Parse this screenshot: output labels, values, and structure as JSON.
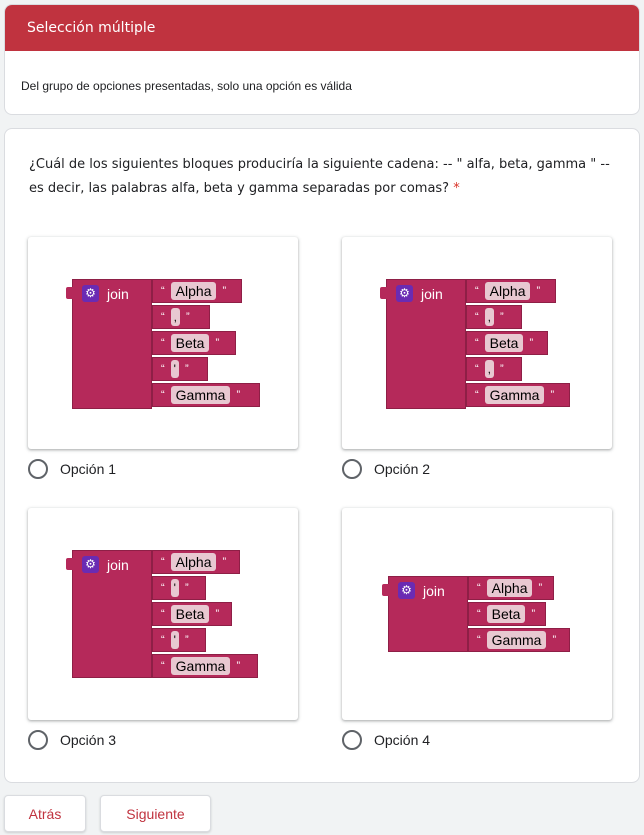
{
  "section": {
    "title": "Selección múltiple",
    "description": "Del grupo de opciones presentadas, solo una opción es válida"
  },
  "question": {
    "text": "¿Cuál de los siguientes bloques produciría la siguiente cadena: -- \" alfa, beta, gamma \" -- es decir, las palabras alfa, beta y gamma separadas por comas?",
    "required_mark": "*"
  },
  "block_label": "join",
  "options": [
    {
      "label": "Opción 1",
      "items": [
        "Alpha",
        ",",
        "Beta",
        "'",
        "Gamma"
      ]
    },
    {
      "label": "Opción 2",
      "items": [
        "Alpha",
        ",",
        "Beta",
        ",",
        "Gamma"
      ]
    },
    {
      "label": "Opción 3",
      "items": [
        "Alpha",
        "'",
        "Beta",
        "'",
        "Gamma"
      ]
    },
    {
      "label": "Opción 4",
      "items": [
        "Alpha",
        "Beta",
        "Gamma"
      ]
    }
  ],
  "nav": {
    "back": "Atrás",
    "next": "Siguiente"
  },
  "colors": {
    "header": "#c0333f",
    "block": "#b5295a",
    "gear": "#6a2bb3"
  },
  "icons": [
    "gear-icon",
    "radio-icon"
  ]
}
